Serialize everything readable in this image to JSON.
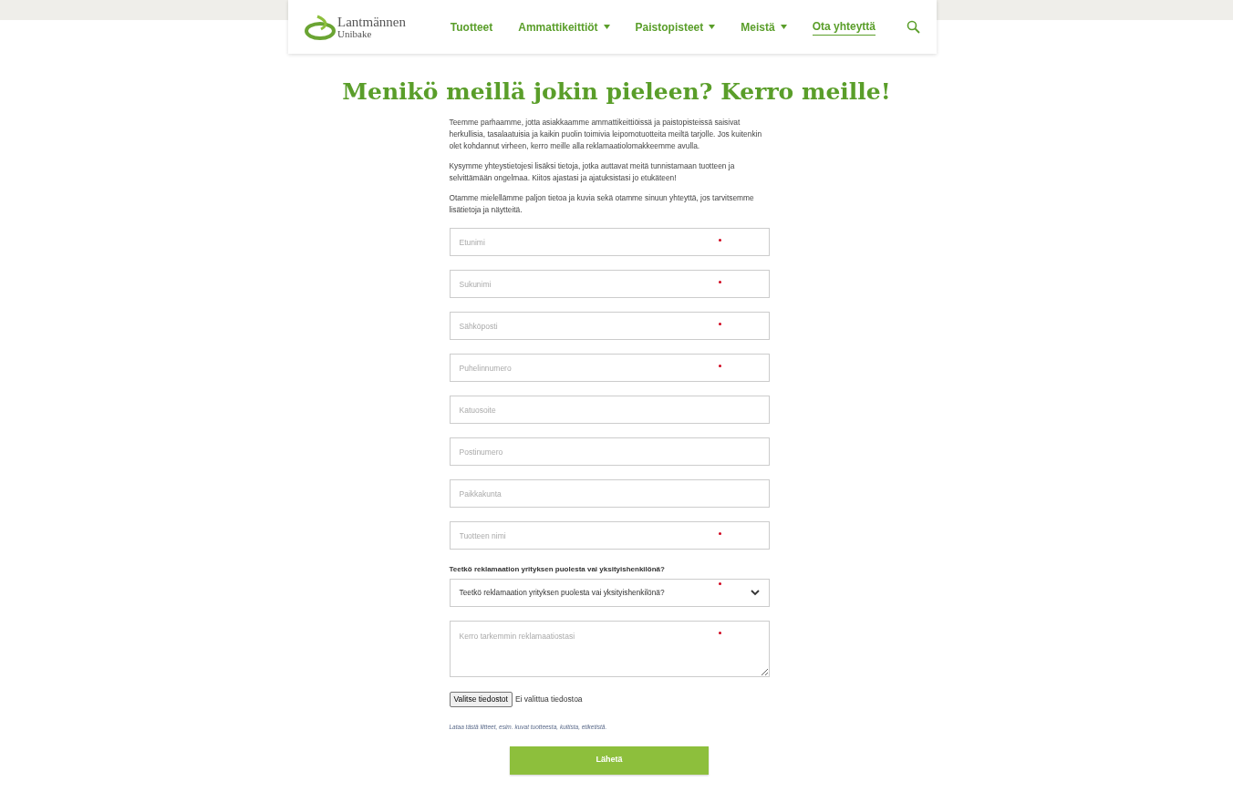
{
  "header": {
    "logo": {
      "name": "Lantmännen",
      "sub": "Unibake"
    },
    "nav": [
      {
        "label": "Tuotteet",
        "has_menu": false,
        "selected": false
      },
      {
        "label": "Ammattikeittiöt",
        "has_menu": true,
        "selected": false
      },
      {
        "label": "Paistopisteet",
        "has_menu": true,
        "selected": false
      },
      {
        "label": "Meistä",
        "has_menu": true,
        "selected": false
      },
      {
        "label": "Ota yhteyttä",
        "has_menu": false,
        "selected": true
      }
    ]
  },
  "title": "Menikö meillä jokin pieleen? Kerro meille!",
  "paragraphs": [
    "Teemme parhaamme, jotta asiakkaamme ammattikeittiöissä ja paistopisteissä saisivat herkullisia, tasalaatuisia ja kaikin puolin toimivia leipomotuotteita meiltä tarjolle. Jos kuitenkin olet kohdannut virheen, kerro meille alla reklamaatiolomakkeemme avulla.",
    "Kysymme yhteystietojesi lisäksi tietoja, jotka auttavat meitä tunnistamaan tuotteen ja selvittämään ongelmaa. Kiitos ajastasi ja ajatuksistasi jo etukäteen!",
    "Otamme mielellämme paljon tietoa ja kuvia sekä otamme sinuun yhteyttä, jos tarvitsemme lisätietoja ja näytteitä."
  ],
  "fields": [
    {
      "placeholder": "Etunimi",
      "required": true
    },
    {
      "placeholder": "Sukunimi",
      "required": true
    },
    {
      "placeholder": "Sähköposti",
      "required": true
    },
    {
      "placeholder": "Puhelinnumero",
      "required": true
    },
    {
      "placeholder": "Katuosoite",
      "required": false
    },
    {
      "placeholder": "Postinumero",
      "required": false
    },
    {
      "placeholder": "Paikkakunta",
      "required": false
    },
    {
      "placeholder": "Tuotteen nimi",
      "required": true
    }
  ],
  "select": {
    "label": "Teetkö reklamaation yrityksen puolesta vai yksityishenkilönä?",
    "value": "Teetkö reklamaation yrityksen puolesta vai yksityishenkilönä?",
    "required": true
  },
  "textarea": {
    "placeholder": "Kerro tarkemmin reklamaatiostasi",
    "required": true
  },
  "file": {
    "button": "Valitse tiedostot",
    "status": "Ei valittua tiedostoa"
  },
  "hint": "Lataa tästä liitteet, esim. kuvat tuotteesta, kuitista, etiketistä.",
  "submit": "Lähetä"
}
